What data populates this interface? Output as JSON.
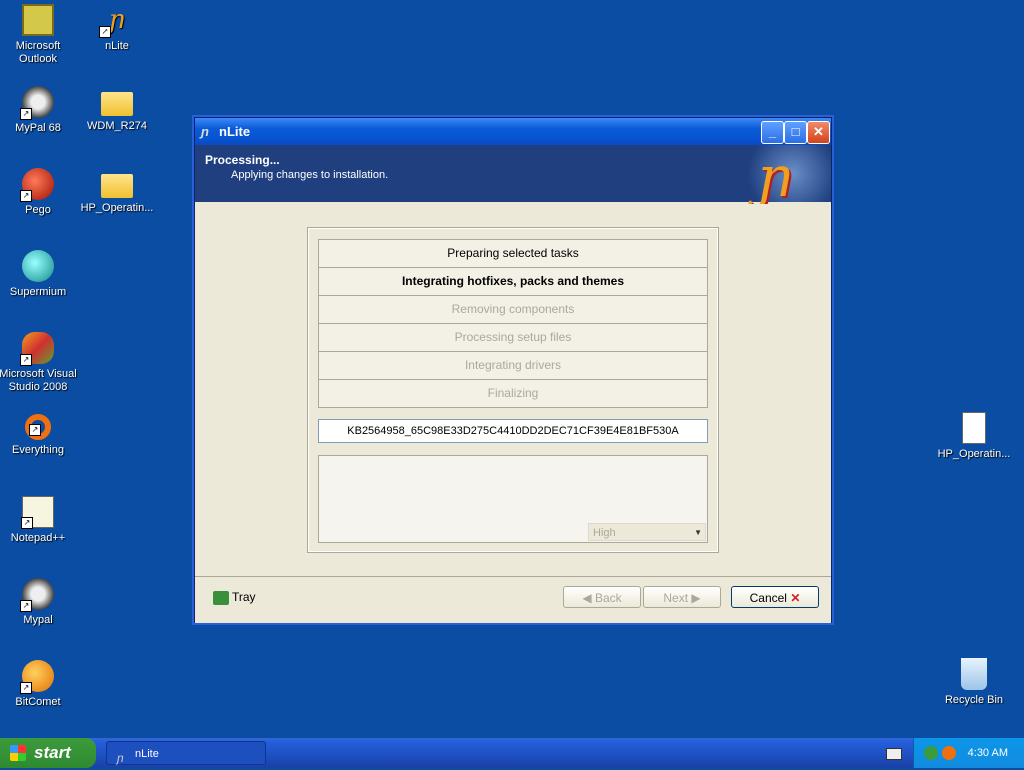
{
  "desktop": {
    "icons_left": [
      {
        "label": "Microsoft Outlook",
        "icon": "outlook-icon",
        "shortcut": false
      },
      {
        "label": "MyPal 68",
        "icon": "raccoon-icon",
        "shortcut": true
      },
      {
        "label": "Pego",
        "icon": "red-orb-icon",
        "shortcut": true
      },
      {
        "label": "Supermium",
        "icon": "globe-icon",
        "shortcut": false
      },
      {
        "label": "Microsoft Visual Studio 2008",
        "icon": "visual-studio-icon",
        "shortcut": true
      },
      {
        "label": "Everything",
        "icon": "search-magnifier-icon",
        "shortcut": true
      },
      {
        "label": "Notepad++",
        "icon": "notepad-icon",
        "shortcut": true
      },
      {
        "label": "Mypal",
        "icon": "raccoon-icon",
        "shortcut": true
      },
      {
        "label": "BitComet",
        "icon": "bitcomet-icon",
        "shortcut": true
      }
    ],
    "icons_col2": [
      {
        "label": "nLite",
        "icon": "nlite-icon",
        "shortcut": true
      },
      {
        "label": "WDM_R274",
        "icon": "folder-icon",
        "shortcut": false
      },
      {
        "label": "HP_Operatin...",
        "icon": "folder-icon",
        "shortcut": false
      }
    ],
    "icons_right": [
      {
        "label": "HP_Operatin...",
        "icon": "document-icon"
      },
      {
        "label": "Recycle Bin",
        "icon": "recycle-bin-icon"
      }
    ]
  },
  "window": {
    "title": "nLite",
    "header_title": "Processing...",
    "header_subtitle": "Applying changes to installation.",
    "tasks": [
      {
        "label": "Preparing selected tasks",
        "state": "done"
      },
      {
        "label": "Integrating hotfixes, packs and themes",
        "state": "active"
      },
      {
        "label": "Removing components",
        "state": "pending"
      },
      {
        "label": "Processing setup files",
        "state": "pending"
      },
      {
        "label": "Integrating drivers",
        "state": "pending"
      },
      {
        "label": "Finalizing",
        "state": "pending"
      }
    ],
    "current_item": "KB2564958_65C98E33D275C4410DD2DEC71CF39E4E81BF530A",
    "priority_value": "High",
    "buttons": {
      "tray": "Tray",
      "back": "Back",
      "next": "Next",
      "cancel": "Cancel"
    }
  },
  "taskbar": {
    "start_label": "start",
    "task_button": "nLite",
    "clock": "4:30 AM"
  }
}
